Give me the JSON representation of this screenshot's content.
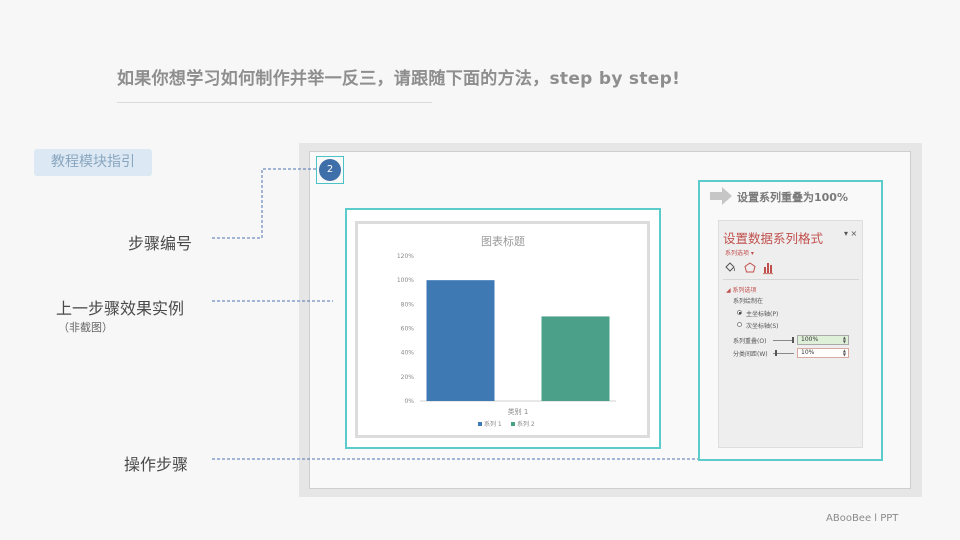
{
  "slide": {
    "headline": "如果你想学习如何制作并举一反三，请跟随下面的方法，step by step!",
    "guide_tag": "教程模块指引",
    "footer": "ABooBee  l  PPT"
  },
  "annotations": {
    "step_number": "步骤编号",
    "previous_example": "上一步骤效果实例",
    "previous_example_note": "（非截图）",
    "operations": "操作步骤"
  },
  "step": {
    "number": "2"
  },
  "operation": {
    "title": "设置系列重叠为100%",
    "arrow_icon": "right-arrow-icon"
  },
  "format_pane": {
    "title": "设置数据系列格式",
    "tools": "▾ ×",
    "subtab": "系列选项 ▾",
    "icons": [
      "fill-bucket-icon",
      "pentagon-icon",
      "bar-chart-icon"
    ],
    "section_title": "◢ 系列选项",
    "plot_on_label": "系列绘制在",
    "primary_axis": "主坐标轴(P)",
    "secondary_axis": "次坐标轴(S)",
    "overlap_label": "系列重叠(O)",
    "overlap_value": "100%",
    "gap_label": "分类间距(W)",
    "gap_value": "10%",
    "accent_color": "#c0504d"
  },
  "chart_data": {
    "type": "bar",
    "title": "图表标题",
    "categories": [
      "类别 1"
    ],
    "series": [
      {
        "name": "系列 1",
        "values": [
          100
        ],
        "color": "#3e79b3"
      },
      {
        "name": "系列 2",
        "values": [
          70
        ],
        "color": "#4aa088"
      }
    ],
    "yticks": [
      "0%",
      "20%",
      "40%",
      "60%",
      "80%",
      "100%",
      "120%"
    ],
    "ylim": [
      0,
      120
    ],
    "legend": "bottom",
    "grid": false
  }
}
